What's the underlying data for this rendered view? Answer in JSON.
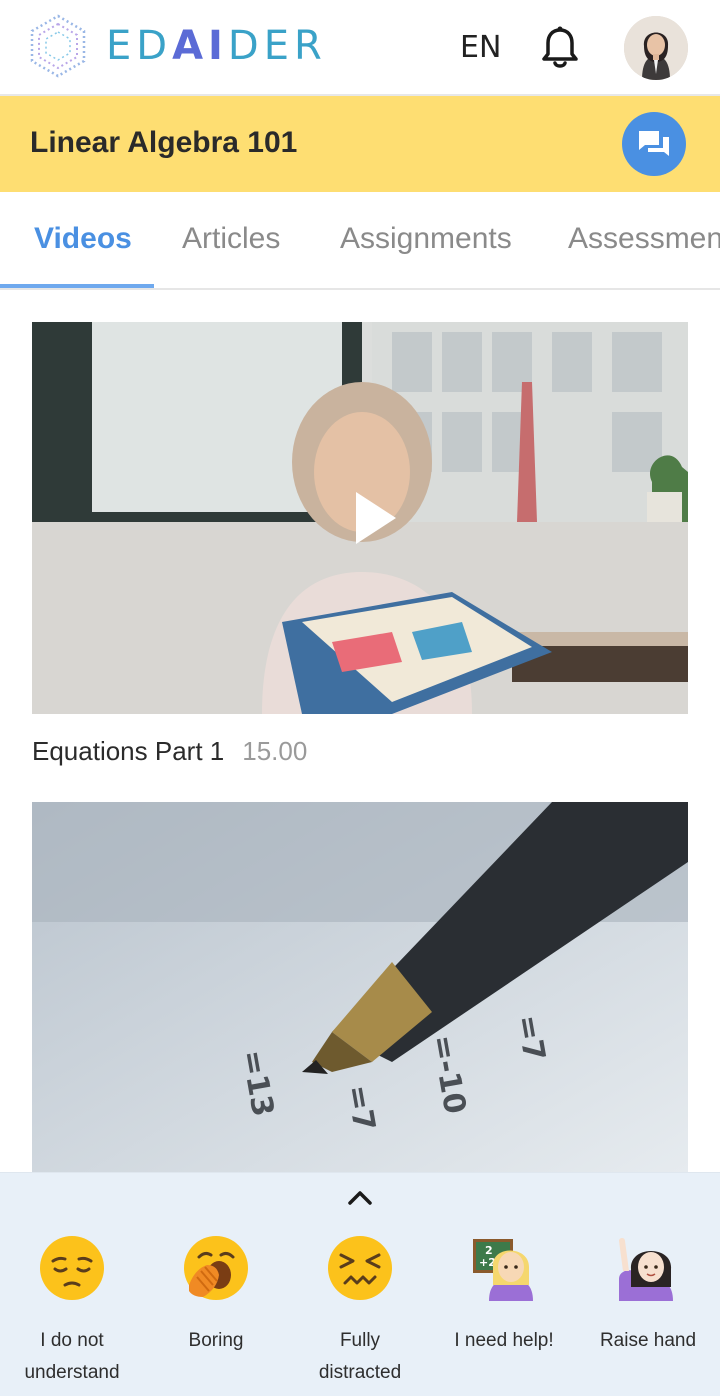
{
  "header": {
    "logo_text_ed": "ED",
    "logo_text_ai": "AI",
    "logo_text_der": "DER",
    "language": "EN",
    "bell_icon": "bell-icon",
    "avatar_icon": "user-avatar"
  },
  "course": {
    "title": "Linear Algebra 101",
    "chat_icon": "chat-icon"
  },
  "tabs": [
    {
      "label": "Videos",
      "active": true
    },
    {
      "label": "Articles",
      "active": false
    },
    {
      "label": "Assignments",
      "active": false
    },
    {
      "label": "Assessments",
      "active": false
    }
  ],
  "videos": [
    {
      "title": "Equations Part 1",
      "duration": "15.00",
      "thumbnail": "girl-reading-book"
    },
    {
      "title": "",
      "duration": "",
      "thumbnail": "pen-on-math-paper"
    }
  ],
  "reactions_panel": {
    "toggle_icon": "chevron-up-icon",
    "items": [
      {
        "label_line1": "I do not",
        "label_line2": "understand",
        "icon": "pensive-face"
      },
      {
        "label_line1": "Boring",
        "label_line2": "",
        "icon": "yawning-face"
      },
      {
        "label_line1": "Fully",
        "label_line2": "distracted",
        "icon": "confounded-face"
      },
      {
        "label_line1": "I need help!",
        "label_line2": "",
        "icon": "teacher-emoji"
      },
      {
        "label_line1": "Raise hand",
        "label_line2": "",
        "icon": "raising-hand-emoji"
      }
    ]
  },
  "colors": {
    "accent": "#4a90e2",
    "course_bar": "#fede72",
    "panel": "#e8f0f8"
  }
}
